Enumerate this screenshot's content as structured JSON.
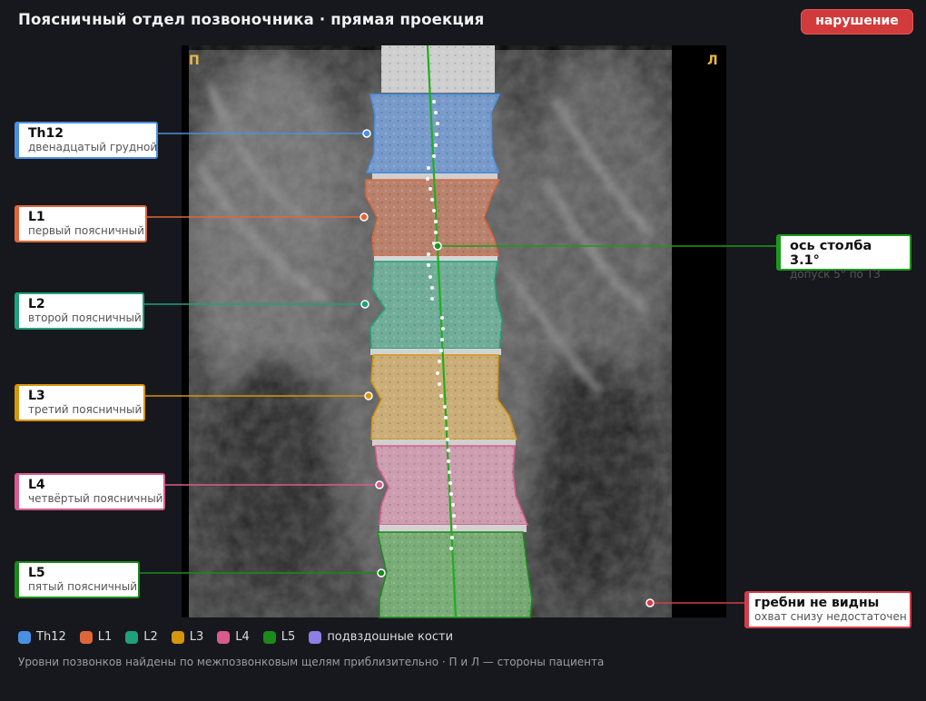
{
  "header": {
    "title": "Поясничный отдел позвоночника · прямая проекция",
    "status_badge": "нарушение"
  },
  "image": {
    "side_left": "П",
    "side_right": "Л"
  },
  "vertebrae": [
    {
      "id": "th12",
      "label": "Th12",
      "description": "двенадцатый грудной",
      "color": "#4a90e2"
    },
    {
      "id": "l1",
      "label": "L1",
      "description": "первый поясничный",
      "color": "#e0663a"
    },
    {
      "id": "l2",
      "label": "L2",
      "description": "второй поясничный",
      "color": "#21a07a"
    },
    {
      "id": "l3",
      "label": "L3",
      "description": "третий поясничный",
      "color": "#d4960e"
    },
    {
      "id": "l4",
      "label": "L4",
      "description": "четвёртый поясничный",
      "color": "#d95b8e"
    },
    {
      "id": "l5",
      "label": "L5",
      "description": "пятый поясничный",
      "color": "#1a8a1a"
    }
  ],
  "axis": {
    "title": "ось столба 3.1°",
    "subtitle": "допуск 5° по ТЗ",
    "color": "#1a9a1a"
  },
  "warning": {
    "title": "гребни не видны",
    "subtitle": "охват снизу недостаточен",
    "color": "#d43c4a"
  },
  "legend": [
    {
      "label": "Th12",
      "color": "#4a90e2"
    },
    {
      "label": "L1",
      "color": "#e0663a"
    },
    {
      "label": "L2",
      "color": "#21a07a"
    },
    {
      "label": "L3",
      "color": "#d4960e"
    },
    {
      "label": "L4",
      "color": "#d95b8e"
    },
    {
      "label": "L5",
      "color": "#1a8a1a"
    },
    {
      "label": "подвздошные кости",
      "color": "#8e7fe6"
    }
  ],
  "footnote": "Уровни позвонков найдены по межпозвонковым щелям приблизительно · П и Л — стороны пациента"
}
